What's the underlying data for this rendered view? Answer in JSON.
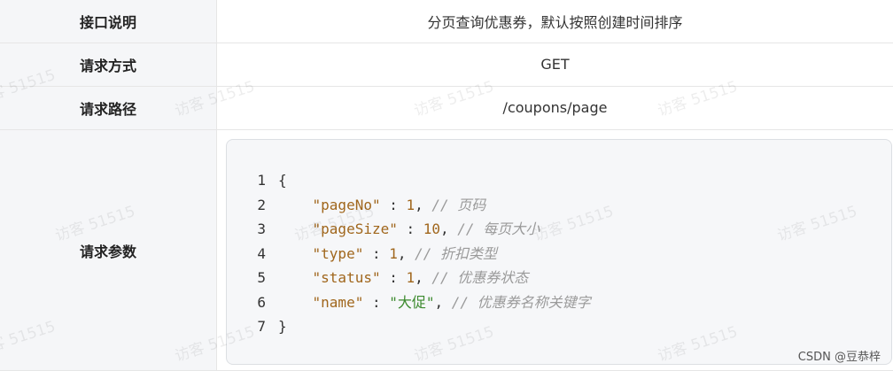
{
  "rows": [
    {
      "label": "接口说明",
      "value": "分页查询优惠券，默认按照创建时间排序"
    },
    {
      "label": "请求方式",
      "value": "GET"
    },
    {
      "label": "请求路径",
      "value": "/coupons/page"
    },
    {
      "label": "请求参数"
    }
  ],
  "code": {
    "lines": [
      {
        "n": "1",
        "open": "{"
      },
      {
        "n": "2",
        "key": "\"pageNo\"",
        "sep": " : ",
        "val": "1",
        "comma": ", ",
        "comment": "// 页码"
      },
      {
        "n": "3",
        "key": "\"pageSize\"",
        "sep": " : ",
        "val": "10",
        "comma": ", ",
        "comment": "// 每页大小"
      },
      {
        "n": "4",
        "key": "\"type\"",
        "sep": " : ",
        "val": "1",
        "comma": ", ",
        "comment": "// 折扣类型"
      },
      {
        "n": "5",
        "key": "\"status\"",
        "sep": " : ",
        "val": "1",
        "comma": ", ",
        "comment": "// 优惠券状态"
      },
      {
        "n": "6",
        "key": "\"name\"",
        "sep": " : ",
        "val": "\"大促\"",
        "comma": ", ",
        "comment": "// 优惠券名称关键字"
      },
      {
        "n": "7",
        "open": "}"
      }
    ]
  },
  "watermark_text": "访客 51515",
  "credit": "CSDN @豆恭梓"
}
